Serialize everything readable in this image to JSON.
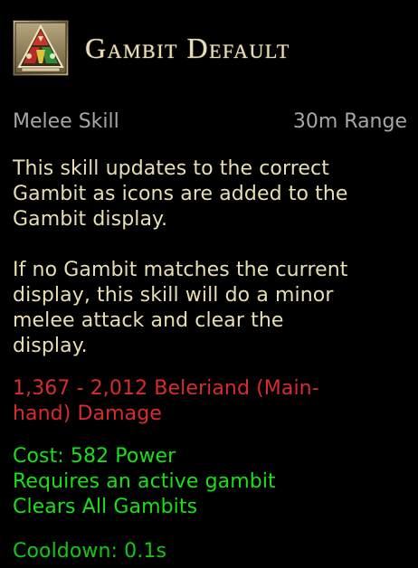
{
  "skill": {
    "title": "Gambit Default",
    "type_label": "Melee Skill",
    "range_label": "30m Range",
    "description": "This skill updates to the correct\nGambit as icons are added to the\nGambit display.\n\nIf no Gambit matches the current\ndisplay, this skill will do a minor\nmelee attack and clear the\ndisplay.",
    "damage": "1,367 - 2,012 Beleriand (Main-\nhand) Damage",
    "cost_lines": "Cost: 582 Power\nRequires an active gambit\nClears All Gambits",
    "cooldown": "Cooldown: 0.1s"
  },
  "colors": {
    "title": "#e9ddb6",
    "meta": "#a6a6a6",
    "description": "#e7dfb2",
    "damage": "#d92b2b",
    "cost": "#18e016",
    "cooldown": "#11c811",
    "background": "#000000"
  },
  "icons": {
    "skill_icon": "gambit-triangle-icon"
  }
}
